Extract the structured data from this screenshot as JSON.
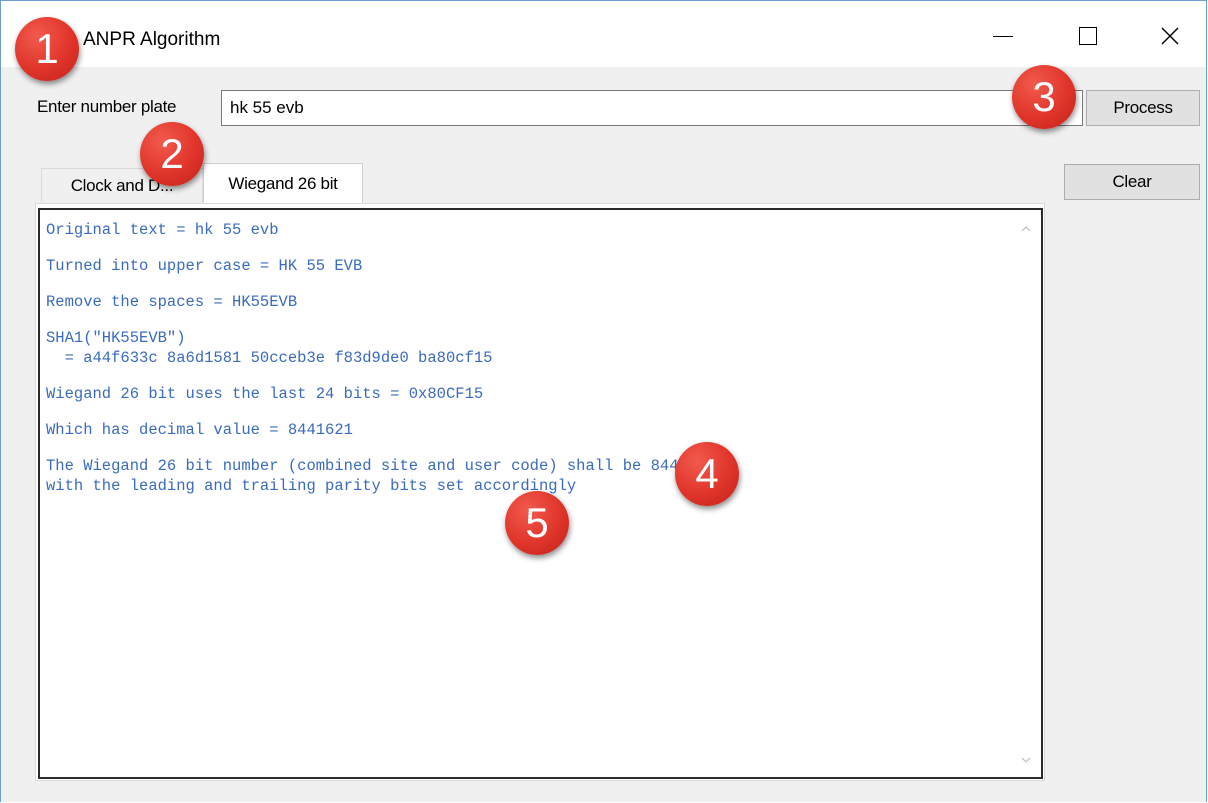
{
  "window": {
    "title": "ANPR Algorithm",
    "close_glyph": "✕"
  },
  "form": {
    "plate_label": "Enter number plate",
    "plate_value": "hk 55 evb",
    "process_label": "Process",
    "clear_label": "Clear"
  },
  "tabs": [
    {
      "label": "Clock and D..."
    },
    {
      "label": "Wiegand 26 bit",
      "active": true
    }
  ],
  "output": {
    "lines": [
      "Original text = hk 55 evb",
      "",
      "Turned into upper case = HK 55 EVB",
      "",
      "Remove the spaces = HK55EVB",
      "",
      "SHA1(\"HK55EVB\")",
      "  = a44f633c 8a6d1581 50cceb3e f83d9de0 ba80cf15",
      "",
      "Wiegand 26 bit uses the last 24 bits = 0x80CF15",
      "",
      "Which has decimal value = 8441621",
      "",
      "The Wiegand 26 bit number (combined site and user code) shall be 8441621,",
      "with the leading and trailing parity bits set accordingly"
    ]
  },
  "badges": [
    "1",
    "2",
    "3",
    "4",
    "5"
  ],
  "colors": {
    "output_text": "#3a6bbf",
    "badge": "#e0342a"
  }
}
